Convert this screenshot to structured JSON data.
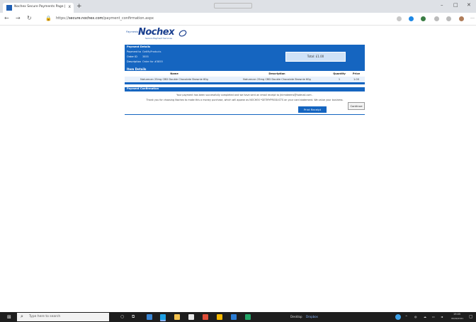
{
  "browser": {
    "tab_title": "Nochex Secure Payments Page |",
    "tab_close": "x",
    "new_tab": "+",
    "url_prefix": "https://",
    "url_domain": "secure.nochex.com",
    "url_path": "/payment_confirmation.aspx"
  },
  "logo": {
    "powered_by": "Payments By",
    "brand": "Nochex",
    "tagline": "Secure Payment Services"
  },
  "payment_details": {
    "header": "Payment Details",
    "rows": [
      {
        "label": "Payment to",
        "value": "GetMyProducts"
      },
      {
        "label": "Order ID",
        "value": "3855"
      },
      {
        "label": "Description",
        "value": "Order for #3855"
      }
    ],
    "total": "Total: £1.00"
  },
  "items": {
    "header": "Item Details",
    "columns": [
      "Name",
      "Description",
      "Quantity",
      "Price"
    ],
    "rows": [
      [
        "Naturecan 25mg CBD Double Chocolate Brownie 60g",
        "Naturecan 25mg CBD Double Chocolate Brownie 60g",
        "1",
        "1.00"
      ]
    ]
  },
  "confirmation": {
    "header": "Payment Confirmation",
    "line1": "Your payment has been successfully completed and we have sent an email receipt to jhirmdeems@hotmail.com .",
    "line2": "Thank you for choosing Nochex to make this a money purchase, which will appear as NOCHEX *GETMYPRODUCTS on your card statement. We value your business.",
    "print_label": "Print Receipt",
    "continue_label": "Continue"
  },
  "taskbar": {
    "search_placeholder": "Type here to search",
    "desktop_label": "Desktop",
    "dropbox_label": "Dropbox",
    "time": "19:05",
    "date": "06/09/2021"
  },
  "colors": {
    "brand_blue": "#1565c0",
    "logo_blue": "#1a3f8f",
    "total_box": "#cfe2f7"
  }
}
